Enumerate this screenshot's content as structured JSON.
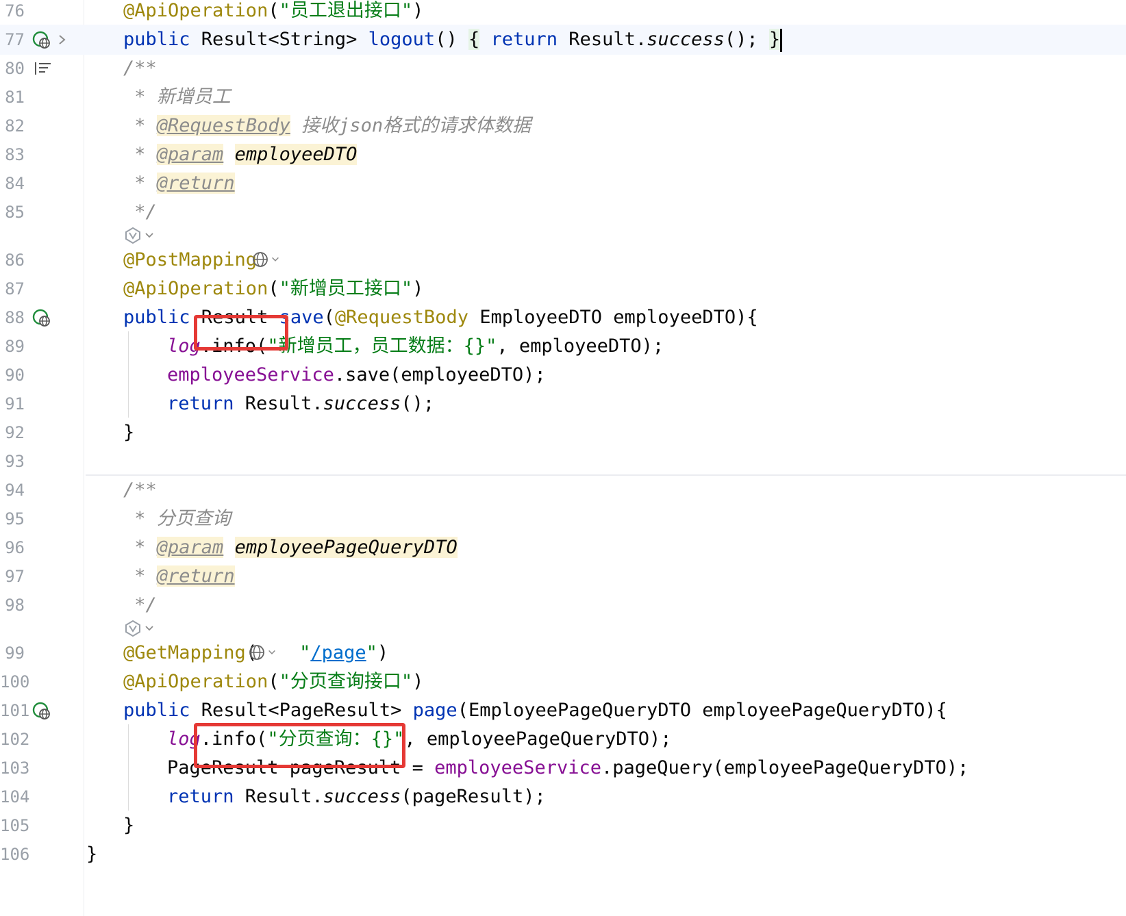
{
  "editor": {
    "line_numbers": [
      "76",
      "77",
      "80",
      "81",
      "82",
      "83",
      "84",
      "85",
      "86",
      "87",
      "88",
      "89",
      "90",
      "91",
      "92",
      "93",
      "94",
      "95",
      "96",
      "97",
      "98",
      "99",
      "100",
      "101",
      "102",
      "103",
      "104",
      "105",
      "106"
    ],
    "code": {
      "l76": {
        "ann": "@ApiOperation",
        "open": "(",
        "str": "\"员工退出接口\"",
        "close": ")"
      },
      "l77": {
        "kw1": "public",
        "t1": " Result<String> ",
        "m": "logout",
        "t2": "() ",
        "b1": "{",
        "t3": " ",
        "kw2": "return",
        "t4": " Result.",
        "call": "success",
        "t5": "(); ",
        "b2": "}"
      },
      "l80": {
        "c": "/**"
      },
      "l81": {
        "star": " * ",
        "c": "新增员工"
      },
      "l82": {
        "star": " * ",
        "tag": "@RequestBody",
        "c": " 接收json格式的请求体数据"
      },
      "l83": {
        "star": " * ",
        "tag": "@param",
        "sp": " ",
        "arg": "employeeDTO"
      },
      "l84": {
        "star": " * ",
        "tag": "@return"
      },
      "l85": {
        "c": " */"
      },
      "l86": {
        "ann": "@PostMapping"
      },
      "l87": {
        "ann": "@ApiOperation",
        "open": "(",
        "str": "\"新增员工接口\"",
        "close": ")"
      },
      "l88": {
        "kw": "public",
        "t1": " Result ",
        "m": "save",
        "open": "(",
        "ann": "@RequestBody",
        "t2": " EmployeeDTO employeeDTO){"
      },
      "l89": {
        "fld": "log",
        "t1": ".info(",
        "str": "\"新增员工，员工数据：{}\"",
        "t2": ", employeeDTO);"
      },
      "l90": {
        "fld": "employeeService",
        "t1": ".save(employeeDTO);"
      },
      "l91": {
        "kw": "return",
        "t1": " Result.",
        "call": "success",
        "t2": "();"
      },
      "l92": {
        "t": "}"
      },
      "l94": {
        "c": "/**"
      },
      "l95": {
        "star": " * ",
        "c": "分页查询"
      },
      "l96": {
        "star": " * ",
        "tag": "@param",
        "sp": " ",
        "arg": "employeePageQueryDTO"
      },
      "l97": {
        "star": " * ",
        "tag": "@return"
      },
      "l98": {
        "c": " */"
      },
      "l99": {
        "ann": "@GetMapping",
        "open": "(",
        "q1": "\"",
        "url": "/page",
        "q2": "\"",
        "close": ")"
      },
      "l100": {
        "ann": "@ApiOperation",
        "open": "(",
        "str": "\"分页查询接口\"",
        "close": ")"
      },
      "l101": {
        "kw": "public",
        "t1": " Result<PageResult> ",
        "m": "page",
        "t2": "(EmployeePageQueryDTO employeePageQueryDTO){"
      },
      "l102": {
        "fld": "log",
        "t1": ".info(",
        "str": "\"分页查询：{}\"",
        "t2": ", employeePageQueryDTO);"
      },
      "l103": {
        "t1": "PageResult pageResult = ",
        "fld": "employeeService",
        "t2": ".pageQuery(employeePageQueryDTO);"
      },
      "l104": {
        "kw": "return",
        "t1": " Result.",
        "call": "success",
        "t2": "(pageResult);"
      },
      "l105": {
        "t": "}"
      },
      "l106": {
        "t": "}"
      }
    },
    "colors": {
      "keyword": "#0033b3",
      "annotation": "#9e880d",
      "string": "#067d17",
      "field": "#871094",
      "comment": "#8c8c8c",
      "doc_highlight": "#fbf3d5",
      "highlight_box": "#e53935",
      "line_number": "#9aa0a8"
    },
    "icons": {
      "run_gutter": "web-endpoint-run-icon",
      "fold": "chevron-right-icon",
      "structure": "bookmark-list-icon",
      "inlay_ai": "ai-assistant-icon",
      "inlay_globe": "globe-icon"
    }
  }
}
